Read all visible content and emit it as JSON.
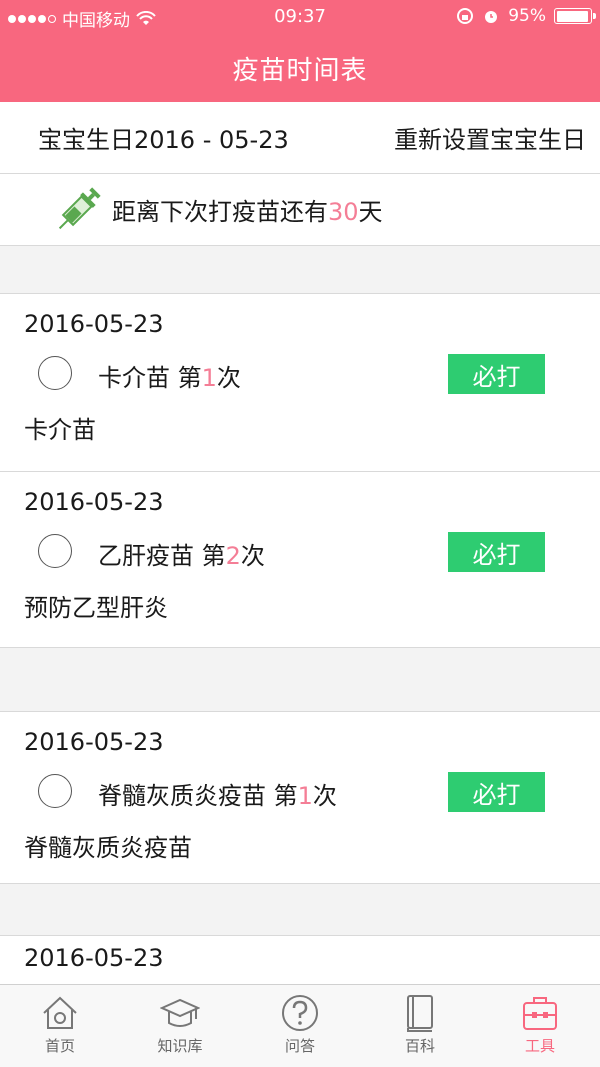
{
  "status_bar": {
    "carrier": "中国移动",
    "time": "09:37",
    "battery": "95%",
    "battery_level": 0.95
  },
  "header": {
    "title": "疫苗时间表"
  },
  "birthday": {
    "label": "宝宝生日2016 - 05-23",
    "reset_label": "重新设置宝宝生日"
  },
  "countdown": {
    "prefix": "距离下次打疫苗还有",
    "days": "30",
    "suffix": "天",
    "icon": "syringe-icon"
  },
  "vaccines": [
    {
      "date": "2016-05-23",
      "name": "卡介苗 第",
      "dose": "1",
      "dose_suffix": "次",
      "tag": "必打",
      "description": "卡介苗"
    },
    {
      "date": "2016-05-23",
      "name": "乙肝疫苗 第",
      "dose": "2",
      "dose_suffix": "次",
      "tag": "必打",
      "description": "预防乙型肝炎"
    },
    {
      "date": "2016-05-23",
      "name": "脊髓灰质炎疫苗 第",
      "dose": "1",
      "dose_suffix": "次",
      "tag": "必打",
      "description": "脊髓灰质炎疫苗"
    },
    {
      "date": "2016-05-23"
    }
  ],
  "tabs": [
    {
      "label": "首页",
      "icon": "home-icon"
    },
    {
      "label": "知识库",
      "icon": "graduation-cap-icon"
    },
    {
      "label": "问答",
      "icon": "question-icon"
    },
    {
      "label": "百科",
      "icon": "book-icon"
    },
    {
      "label": "工具",
      "icon": "toolbox-icon",
      "active": true
    }
  ],
  "colors": {
    "brand": "#f8677f",
    "accent_pink": "#f47e96",
    "must_green": "#2ecc71"
  }
}
